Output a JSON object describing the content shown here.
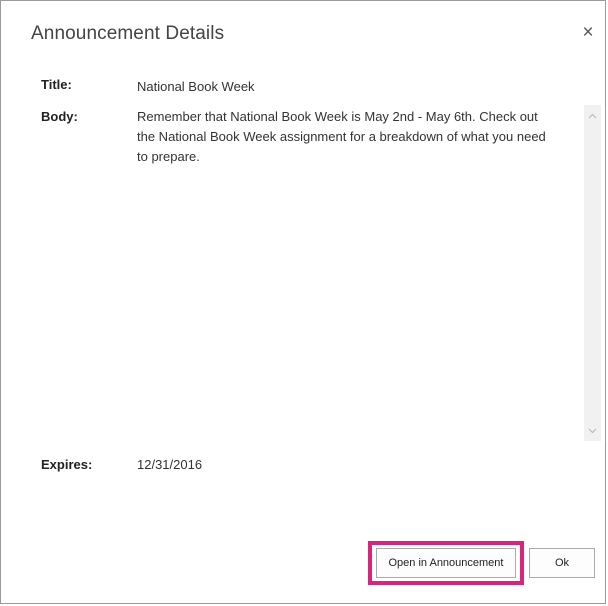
{
  "dialog": {
    "title": "Announcement Details",
    "close_symbol": "×"
  },
  "fields": {
    "title_label": "Title:",
    "title_value": "National Book Week",
    "body_label": "Body:",
    "body_value": "Remember that National Book Week is May 2nd - May 6th. Check out the National Book Week assignment for a breakdown of what you need to prepare.",
    "expires_label": "Expires:",
    "expires_value": "12/31/2016"
  },
  "buttons": {
    "open_label": "Open in Announcement",
    "ok_label": "Ok"
  },
  "colors": {
    "highlight": "#d6257a",
    "scrollbar_track": "#f1f1f1"
  }
}
